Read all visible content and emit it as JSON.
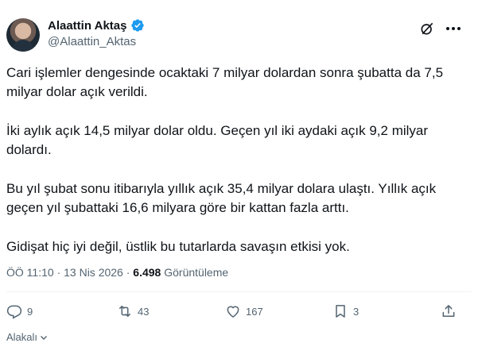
{
  "author": {
    "display_name": "Alaattin Aktaş",
    "handle": "@Alaattin_Aktas"
  },
  "tweet": {
    "paragraphs": [
      "Cari işlemler dengesinde ocaktaki 7 milyar dolardan sonra şubatta da 7,5\nmilyar dolar açık verildi.",
      "İki aylık açık 14,5 milyar dolar oldu. Geçen yıl iki aydaki açık 9,2 milyar\ndolardı.",
      "Bu yıl şubat sonu itibarıyla yıllık açık 35,4 milyar dolara ulaştı. Yıllık açık\ngeçen yıl şubattaki 16,6 milyara göre bir kattan fazla arttı.",
      "Gidişat hiç iyi değil, üstlik bu tutarlarda savaşın etkisi yok."
    ],
    "time": "ÖÖ 11:10",
    "separator": "·",
    "date": "13 Nis 2026",
    "views_count": "6.498",
    "views_label": "Görüntüleme"
  },
  "actions": {
    "replies": "9",
    "reposts": "43",
    "likes": "167",
    "bookmarks": "3"
  },
  "related_label": "Alakalı",
  "icons": [
    "verified-badge-icon",
    "grok-icon",
    "more-icon",
    "reply-icon",
    "repost-icon",
    "like-icon",
    "bookmark-icon",
    "share-icon",
    "chevron-down-icon"
  ],
  "colors": {
    "verified": "#1d9bf0",
    "secondary_text": "#536471",
    "text": "#0f1419"
  }
}
